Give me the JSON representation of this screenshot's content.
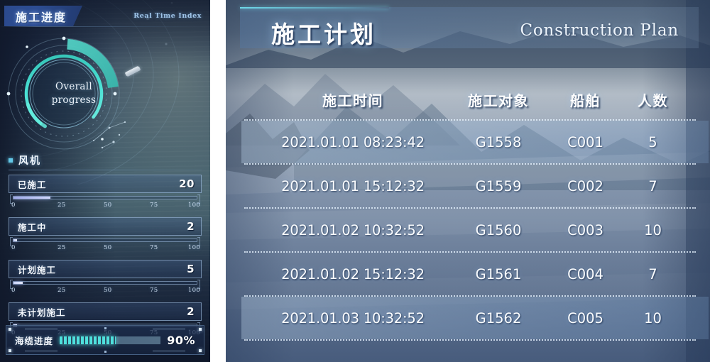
{
  "left_panel": {
    "title": "施工进度",
    "subtitle": "Real Time Index",
    "gauge": {
      "label_line1": "Overall",
      "label_line2": "progress",
      "arc_color": "#3fd0c4",
      "ring_color": "#49e0d4"
    },
    "section_label": "风机",
    "metrics": [
      {
        "name": "已施工",
        "value": "20",
        "percent": 20,
        "ticks": [
          "0",
          "25",
          "50",
          "75",
          "100"
        ]
      },
      {
        "name": "施工中",
        "value": "2",
        "percent": 2,
        "ticks": [
          "0",
          "25",
          "50",
          "75",
          "100"
        ]
      },
      {
        "name": "计划施工",
        "value": "5",
        "percent": 5,
        "ticks": [
          "0",
          "25",
          "50",
          "75",
          "100"
        ]
      },
      {
        "name": "未计划施工",
        "value": "2",
        "percent": 2,
        "ticks": [
          "0",
          "25",
          "50",
          "75",
          "100"
        ]
      }
    ],
    "cable_progress": {
      "name": "海缆进度",
      "percent_label": "90%",
      "bar_fill_color": "#4fe0dc"
    }
  },
  "right_panel": {
    "title": "施工计划",
    "title_en": "Construction Plan",
    "accent_color": "#6fd8e8",
    "table": {
      "columns": [
        "施工时间",
        "施工对象",
        "船舶",
        "人数"
      ],
      "rows": [
        {
          "time": "2021.01.01 08:23:42",
          "object": "G1558",
          "ship": "C001",
          "people": "5",
          "highlight": true
        },
        {
          "time": "2021.01.01 15:12:32",
          "object": "G1559",
          "ship": "C002",
          "people": "7",
          "highlight": false
        },
        {
          "time": "2021.01.02 10:32:52",
          "object": "G1560",
          "ship": "C003",
          "people": "10",
          "highlight": false
        },
        {
          "time": "2021.01.02 15:12:32",
          "object": "G1561",
          "ship": "C004",
          "people": "7",
          "highlight": false
        },
        {
          "time": "2021.01.03 10:32:52",
          "object": "G1562",
          "ship": "C005",
          "people": "10",
          "highlight": true
        }
      ]
    }
  }
}
